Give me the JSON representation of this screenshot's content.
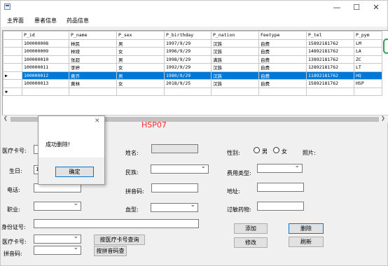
{
  "window": {
    "minimize_glyph": "—",
    "maximize_glyph": "☐",
    "close_glyph": "✕"
  },
  "menu": {
    "items": [
      {
        "label": "主界面"
      },
      {
        "label": "患者信息"
      },
      {
        "label": "药品信息"
      }
    ]
  },
  "grid": {
    "columns": [
      "P_id",
      "P_name",
      "P_sex",
      "P_birthday",
      "P_nation",
      "Feetype",
      "P_tel",
      "P_pym"
    ],
    "rows": [
      {
        "marker": "",
        "cells": [
          "100000008",
          "林民",
          "男",
          "1997/9/29",
          "汉族",
          "自费",
          "15892181762",
          "LM"
        ]
      },
      {
        "marker": "",
        "cells": [
          "100000009",
          "林娅",
          "女",
          "1996/9/29",
          "汉族",
          "自费",
          "14892181762",
          "LA"
        ]
      },
      {
        "marker": "",
        "cells": [
          "100000010",
          "张超",
          "男",
          "1998/9/29",
          "满族",
          "自费",
          "13892181762",
          "ZC"
        ]
      },
      {
        "marker": "",
        "cells": [
          "100000011",
          "李婷",
          "女",
          "1992/9/29",
          "汉族",
          "自费",
          "12892181762",
          "LT"
        ]
      },
      {
        "marker": "▶",
        "cells": [
          "100000012",
          "黄齐",
          "男",
          "1980/9/29",
          "汉族",
          "自费",
          "11892181762",
          "HQ"
        ]
      },
      {
        "marker": "",
        "cells": [
          "100000013",
          "黄林",
          "女",
          "2018/9/25",
          "汉族",
          "自费",
          "15892181762",
          "HSP"
        ]
      }
    ],
    "new_row_marker": "✱",
    "selected_index": 4
  },
  "brand_text": "HSP07",
  "dialog": {
    "message": "成功删除!",
    "ok_label": "确定",
    "close_glyph": "✕"
  },
  "form": {
    "card_no_label": "医疗卡号:",
    "birthday_label": "生日:",
    "birthday_value": "19",
    "phone_label": "电话:",
    "job_label": "职业:",
    "idcard_label": "身份证号:",
    "card_no2_label": "医疗卡号:",
    "pinyin2_label": "拼音码:",
    "query_card_label": "按医疗卡号查询",
    "query_pinyin_label": "按拼音码查",
    "name_label": "姓名:",
    "nation_label": "民族:",
    "pinyin_label": "拼音码:",
    "blood_label": "血型:",
    "sex_label": "性别:",
    "male_label": "男",
    "female_label": "女",
    "photo_label": "照片:",
    "feetype_label": "费用类型:",
    "address_label": "地址:",
    "allergy_label": "过敏药物:",
    "add_label": "添加",
    "delete_label": "删除",
    "modify_label": "修改",
    "refresh_label": "刷新"
  },
  "colors": {
    "selection": "#0078d7",
    "brand": "#ff2a2a"
  }
}
